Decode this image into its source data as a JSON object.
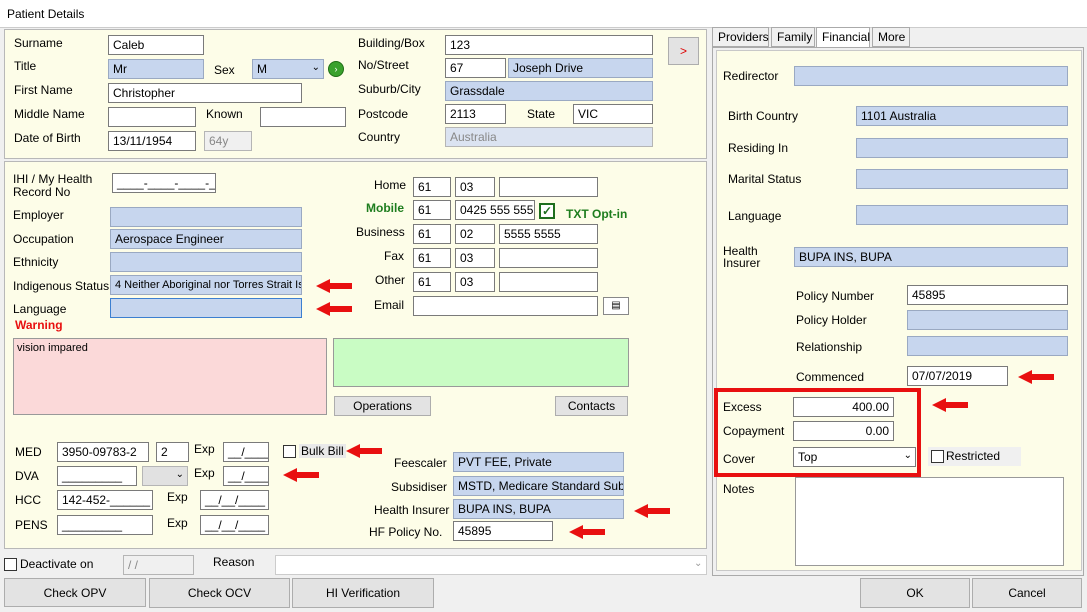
{
  "window": {
    "title": "Patient Details"
  },
  "personal": {
    "surname_label": "Surname",
    "surname": "Caleb",
    "title_label": "Title",
    "title": "Mr",
    "sex_label": "Sex",
    "sex": "M",
    "first_label": "First Name",
    "first": "Christopher",
    "middle_label": "Middle Name",
    "middle": "",
    "known_label": "Known",
    "known": "",
    "dob_label": "Date of Birth",
    "dob": "13/11/1954",
    "age": "64y"
  },
  "address": {
    "building_label": "Building/Box",
    "building": "123",
    "street_label": "No/Street",
    "no": "67",
    "street": "Joseph Drive",
    "suburb_label": "Suburb/City",
    "suburb": "Grassdale",
    "postcode_label": "Postcode",
    "postcode": "2113",
    "state_label": "State",
    "state": "VIC",
    "country_label": "Country",
    "country": "Australia",
    "next_button": ">"
  },
  "details": {
    "ihi_label": "IHI / My Health Record No",
    "ihi": "____-____-____-____",
    "employer_label": "Employer",
    "employer": "",
    "occupation_label": "Occupation",
    "occupation": "Aerospace Engineer",
    "ethnicity_label": "Ethnicity",
    "ethnicity": "",
    "indigenous_label": "Indigenous Status",
    "indigenous": "4   Neither Aboriginal nor Torres Strait Is",
    "language_label": "Language",
    "language": "",
    "warning_label": "Warning",
    "warning_text": "vision impared"
  },
  "phones": {
    "home_label": "Home",
    "home": [
      "61",
      "03",
      ""
    ],
    "mobile_label": "Mobile",
    "mobile": [
      "61",
      "0425 555 555"
    ],
    "txt_label": "TXT Opt-in",
    "business_label": "Business",
    "business": [
      "61",
      "02",
      "5555 5555"
    ],
    "fax_label": "Fax",
    "fax": [
      "61",
      "03",
      ""
    ],
    "other_label": "Other",
    "other": [
      "61",
      "03",
      ""
    ],
    "email_label": "Email",
    "email": ""
  },
  "buttons": {
    "operations": "Operations",
    "contacts": "Contacts",
    "check_opv": "Check OPV",
    "check_ocv": "Check OCV",
    "hi_verification": "HI Verification",
    "ok": "OK",
    "cancel": "Cancel"
  },
  "medicare": {
    "med_label": "MED",
    "med": "3950-09783-2",
    "med_irn": "2",
    "exp_label": "Exp",
    "med_exp": "__/____",
    "bulk_bill_label": "Bulk Bill",
    "dva_label": "DVA",
    "dva": "_________",
    "dva_exp": "__/____",
    "hcc_label": "HCC",
    "hcc": "142-452-______",
    "hcc_exp": "__/__/____",
    "pens_label": "PENS",
    "pens": "_________",
    "pens_exp": "__/__/____"
  },
  "billing": {
    "feescaler_label": "Feescaler",
    "feescaler": "PVT FEE, Private",
    "subsidiser_label": "Subsidiser",
    "subsidiser": "MSTD, Medicare Standard Subsidi",
    "health_insurer_label": "Health Insurer",
    "health_insurer": "BUPA INS, BUPA",
    "hf_policy_label": "HF Policy No.",
    "hf_policy": "45895"
  },
  "bottom": {
    "deactivate_label": "Deactivate on",
    "deactivate": " / /",
    "reason_label": "Reason",
    "reason": ""
  },
  "tabs": [
    "Providers",
    "Family",
    "Financial",
    "More"
  ],
  "financial": {
    "redirector_label": "Redirector",
    "redirector": "",
    "birth_country_label": "Birth Country",
    "birth_country": "1101    Australia",
    "residing_label": "Residing In",
    "residing": "",
    "marital_label": "Marital Status",
    "marital": "",
    "language_label": "Language",
    "language": "",
    "health_insurer_label": "Health Insurer",
    "health_insurer": "BUPA INS, BUPA",
    "policy_number_label": "Policy Number",
    "policy_number": "45895",
    "policy_holder_label": "Policy Holder",
    "policy_holder": "",
    "relationship_label": "Relationship",
    "relationship": "",
    "commenced_label": "Commenced",
    "commenced": "07/07/2019",
    "excess_label": "Excess",
    "excess": "400.00",
    "copayment_label": "Copayment",
    "copayment": "0.00",
    "cover_label": "Cover",
    "cover": "Top",
    "restricted_label": "Restricted",
    "notes_label": "Notes",
    "notes": ""
  },
  "colors": {
    "accent_red": "#e81010",
    "field_blue": "#c7d6ee",
    "panel_yellow": "#fdfde8",
    "warning_pink": "#fbd9d9",
    "green_box": "#c9fcc4"
  },
  "icons": {
    "checked_box": "check-icon",
    "dropdown": "chevron-down-icon",
    "contact_card": "contact-card-icon",
    "go": "green-arrow-icon"
  }
}
